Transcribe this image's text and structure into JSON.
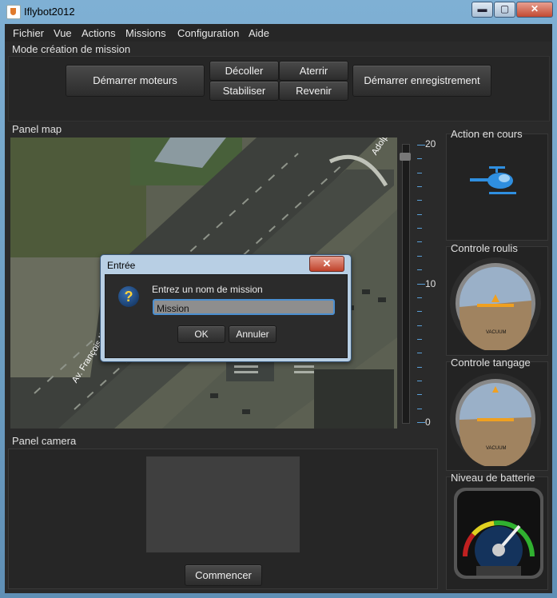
{
  "window": {
    "title": "Iflybot2012",
    "minimize": "▬",
    "maximize": "▢",
    "close": "✕"
  },
  "menu": [
    "Fichier",
    "Vue",
    "Actions",
    "Missions",
    "Configuration",
    "Aide"
  ],
  "mission_creation": {
    "label": "Mode création de mission",
    "start_motors": "Démarrer moteurs",
    "takeoff": "Décoller",
    "land": "Aterrir",
    "stabilize": "Stabiliser",
    "return": "Revenir",
    "start_recording": "Démarrer enregistrement"
  },
  "map_panel": {
    "label": "Panel map",
    "street_1": "Av. François Mitterr",
    "street_2": "Adolp",
    "zoom_max": "20",
    "zoom_mid": "10",
    "zoom_min": "0"
  },
  "camera_panel": {
    "label": "Panel camera",
    "start_button": "Commencer"
  },
  "right": {
    "current_action": "Action en cours",
    "roll": "Controle roulis",
    "pitch": "Controle tangage",
    "battery": "Niveau de batterie",
    "gauge_text": "VACUUM"
  },
  "dialog": {
    "title": "Entrée",
    "close": "✕",
    "icon": "question-icon",
    "prompt": "Entrez un nom de mission",
    "value": "Mission",
    "ok": "OK",
    "cancel": "Annuler"
  },
  "colors": {
    "accent": "#4b8fd0",
    "background": "#2a2a2a",
    "helicopter": "#2f8fe0"
  }
}
